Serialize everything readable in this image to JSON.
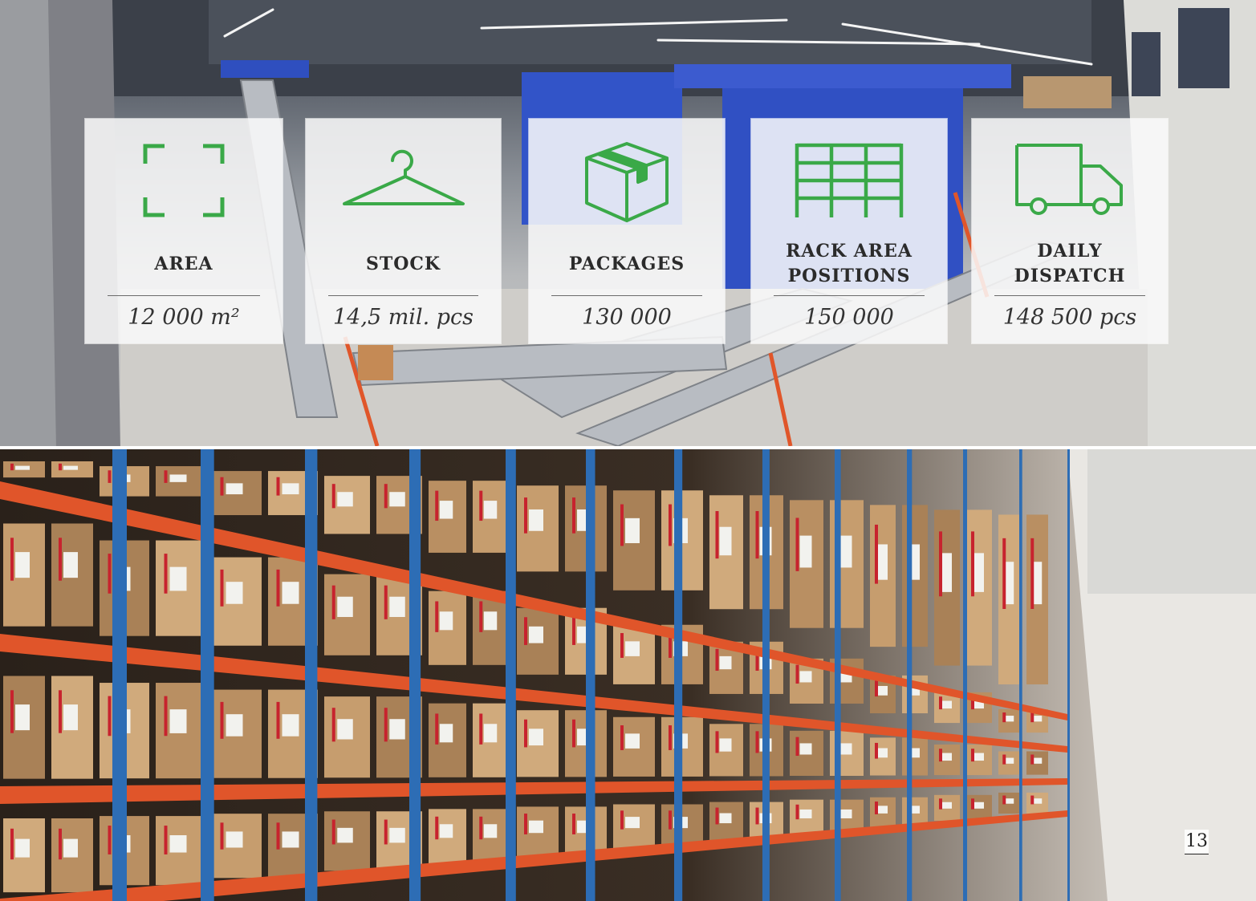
{
  "stats": [
    {
      "icon": "area-corners-icon",
      "label": "AREA",
      "value": "12 000 m²"
    },
    {
      "icon": "hanger-icon",
      "label": "STOCK",
      "value": "14,5 mil. pcs"
    },
    {
      "icon": "package-box-icon",
      "label": "PACKAGES",
      "value": "130 000"
    },
    {
      "icon": "rack-grid-icon",
      "label": "RACK AREA\nPOSITIONS",
      "value": "150 000"
    },
    {
      "icon": "delivery-truck-icon",
      "label": "DAILY\nDISPATCH",
      "value": "148 500 pcs"
    }
  ],
  "page_number": "13",
  "colors": {
    "accent": "#3aa948",
    "text": "#2b2b2b"
  }
}
